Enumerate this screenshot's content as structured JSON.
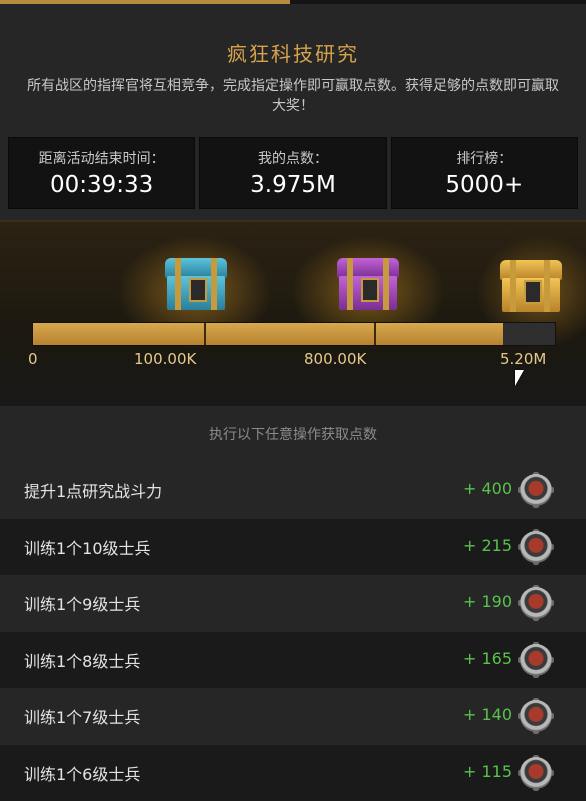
{
  "event": {
    "title": "疯狂科技研究",
    "description": "所有战区的指挥官将互相竞争，完成指定操作即可赢取点数。获得足够的点数即可赢取大奖！"
  },
  "stats": [
    {
      "label": "距离活动结束时间：",
      "value": "00:39:33"
    },
    {
      "label": "我的点数：",
      "value": "3.975M"
    },
    {
      "label": "排行榜：",
      "value": "5000+"
    }
  ],
  "progress": {
    "milestones": [
      "0",
      "100.00K",
      "800.00K",
      "5.20M"
    ],
    "fill_fraction": 0.9,
    "chests": [
      "blue-chest-icon",
      "purple-chest-icon",
      "gold-chest-icon"
    ]
  },
  "instruction": "执行以下任意操作获取点数",
  "tasks": [
    {
      "name": "提升1点研究战斗力",
      "points": "+ 400"
    },
    {
      "name": "训练1个10级士兵",
      "points": "+ 215"
    },
    {
      "name": "训练1个9级士兵",
      "points": "+ 190"
    },
    {
      "name": "训练1个8级士兵",
      "points": "+ 165"
    },
    {
      "name": "训练1个7级士兵",
      "points": "+ 140"
    },
    {
      "name": "训练1个6级士兵",
      "points": "+ 115"
    }
  ],
  "colors": {
    "accent": "#d6a24c",
    "points_green": "#58c24c",
    "bar_gold": "#c8953f"
  }
}
